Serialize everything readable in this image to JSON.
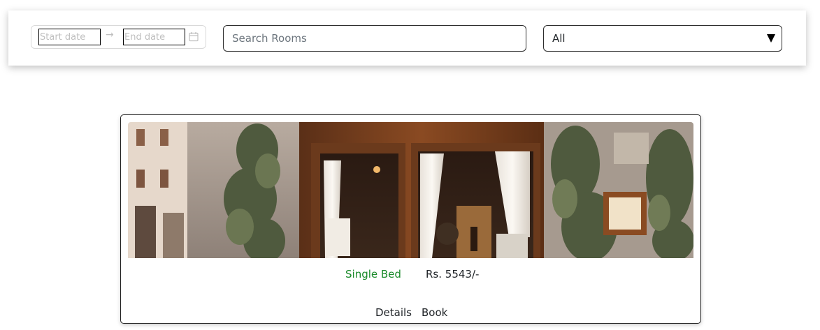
{
  "filters": {
    "start_date_placeholder": "Start date",
    "end_date_placeholder": "End date",
    "date_separator": "→",
    "search_placeholder": "Search Rooms",
    "type_selected": "All"
  },
  "room_card": {
    "room_type": "Single Bed",
    "price": "Rs. 5543/-",
    "details_label": "Details",
    "book_label": "Book"
  },
  "colors": {
    "room_type": "#1a8a2a",
    "border": "#2d2d2d"
  }
}
